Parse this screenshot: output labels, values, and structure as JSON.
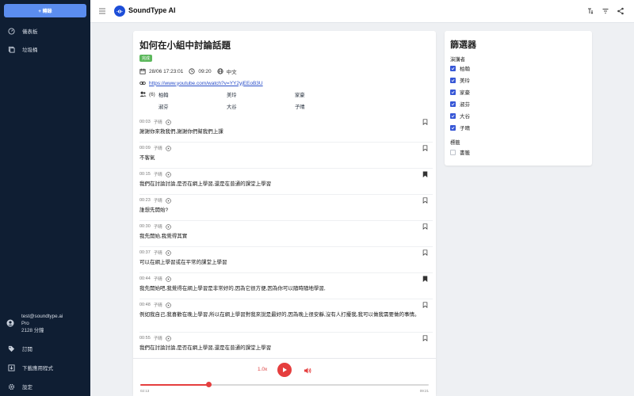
{
  "sidebar": {
    "new_button": "+ 轉錄",
    "items": [
      {
        "label": "儀表板",
        "icon": "dashboard-icon"
      },
      {
        "label": "垃圾桶",
        "icon": "trash-icon"
      }
    ],
    "account": {
      "email": "test@soundtype.ai",
      "plan": "Pro",
      "minutes": "2128 分鐘"
    },
    "bottom_items": [
      {
        "label": "訂閱",
        "icon": "tag-icon"
      },
      {
        "label": "下載應用程式",
        "icon": "download-icon"
      },
      {
        "label": "設定",
        "icon": "settings-icon"
      }
    ]
  },
  "header": {
    "title": "SoundType AI"
  },
  "document": {
    "title": "如何在小組中討論話題",
    "status": "完成",
    "date": "28/06 17:23:01",
    "duration": "09:20",
    "language": "中文",
    "link": "https://www.youtube.com/watch?v=YY2yjEEoB3U",
    "speaker_count": "(6)",
    "speakers": [
      "柏翰",
      "美玲",
      "家豪",
      "淑芬",
      "大谷",
      "子晴"
    ]
  },
  "transcript": [
    {
      "time": "00:03",
      "speaker": "子晴",
      "text": "謝謝你來救我們,謝謝你們幫我們上課",
      "bookmarked": false
    },
    {
      "time": "00:09",
      "speaker": "子晴",
      "text": "不客氣",
      "bookmarked": false
    },
    {
      "time": "00:15",
      "speaker": "子晴",
      "text": "我們在討論討論,是否在網上學習,還是在普通的課堂上學習",
      "bookmarked": true
    },
    {
      "time": "00:23",
      "speaker": "子晴",
      "text": "誰想先開始?",
      "bookmarked": false
    },
    {
      "time": "00:30",
      "speaker": "子晴",
      "text": "我先開始,我覺得其實",
      "bookmarked": false
    },
    {
      "time": "00:37",
      "speaker": "子晴",
      "text": "可以在網上學習或在平常的課堂上學習",
      "bookmarked": false
    },
    {
      "time": "00:44",
      "speaker": "子晴",
      "text": "我先開始吧,我覺得在網上學習是非常好的,因為它很方便,因為你可以隨時隨地學習,",
      "bookmarked": true
    },
    {
      "time": "00:48",
      "speaker": "子晴",
      "text": "例如我自己,我喜歡在晚上學習,所以在網上學習對我來說是最好的,因為晚上很安靜,沒有人打擾我,我可以做我需要做的事情。",
      "bookmarked": false
    },
    {
      "time": "00:55",
      "speaker": "子晴",
      "text": "我們在討論討論,是否在網上學習,還是在普通的課堂上學習",
      "bookmarked": false
    }
  ],
  "player": {
    "speed": "1.0x",
    "current": "02:13",
    "total": "09:21",
    "progress": 0.237
  },
  "filter": {
    "title": "篩選器",
    "speakers_label": "演講者",
    "speakers": [
      {
        "name": "柏翰",
        "checked": true
      },
      {
        "name": "美玲",
        "checked": true
      },
      {
        "name": "家豪",
        "checked": true
      },
      {
        "name": "淑芬",
        "checked": true
      },
      {
        "name": "大谷",
        "checked": true
      },
      {
        "name": "子晴",
        "checked": true
      }
    ],
    "tags_label": "標籤",
    "tags": [
      {
        "name": "書籤",
        "checked": false
      }
    ]
  },
  "colors": {
    "sidebar": "#0f1e33",
    "accent": "#5b8def",
    "player": "#e53e3e",
    "checkbox": "#3757d6",
    "badge": "#5cb85c"
  }
}
